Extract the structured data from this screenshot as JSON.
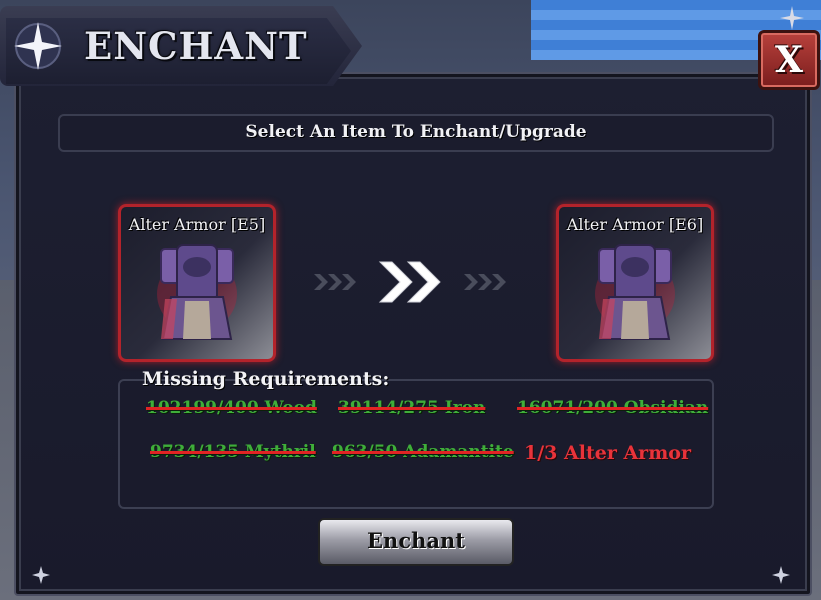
{
  "window": {
    "title": "ENCHANT",
    "close_label": "X"
  },
  "header": {
    "instruction": "Select An Item To Enchant/Upgrade"
  },
  "items": {
    "current": {
      "name": "Alter Armor [E5]"
    },
    "upgraded": {
      "name": "Alter Armor [E6]"
    }
  },
  "requirements": {
    "title": "Missing Requirements:",
    "list": [
      {
        "text": "102199/400 Wood",
        "met": true
      },
      {
        "text": "39114/275 Iron",
        "met": true
      },
      {
        "text": "16071/200 Obsidian",
        "met": true
      },
      {
        "text": "9734/135 Mythril",
        "met": true
      },
      {
        "text": "963/50 Adamantite",
        "met": true
      },
      {
        "text": "1/3 Alter Armor",
        "met": false
      }
    ]
  },
  "actions": {
    "enchant_label": "Enchant"
  },
  "colors": {
    "met": "#3fae3a",
    "missing": "#e8333a",
    "card_border": "#b3232b"
  }
}
